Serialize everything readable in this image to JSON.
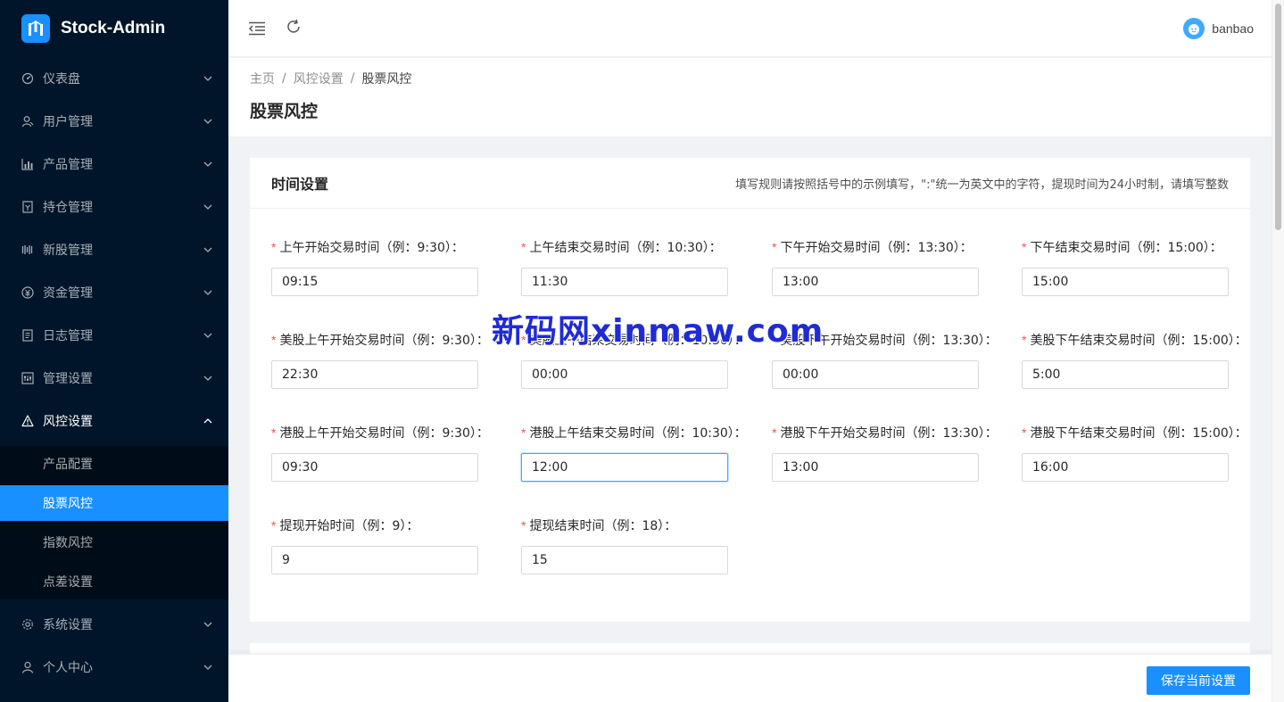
{
  "app": {
    "name": "Stock-Admin"
  },
  "sidebar": {
    "items": [
      {
        "label": "仪表盘",
        "icon": "dashboard-icon"
      },
      {
        "label": "用户管理",
        "icon": "user-icon"
      },
      {
        "label": "产品管理",
        "icon": "chart-icon"
      },
      {
        "label": "持仓管理",
        "icon": "file-icon"
      },
      {
        "label": "新股管理",
        "icon": "barcode-icon"
      },
      {
        "label": "资金管理",
        "icon": "money-icon"
      },
      {
        "label": "日志管理",
        "icon": "log-icon"
      },
      {
        "label": "管理设置",
        "icon": "settings-board-icon"
      },
      {
        "label": "风控设置",
        "icon": "warning-icon"
      },
      {
        "label": "系统设置",
        "icon": "gear-icon"
      },
      {
        "label": "个人中心",
        "icon": "user-icon"
      }
    ],
    "submenu": [
      {
        "label": "产品配置"
      },
      {
        "label": "股票风控"
      },
      {
        "label": "指数风控"
      },
      {
        "label": "点差设置"
      }
    ]
  },
  "header": {
    "username": "banbao"
  },
  "breadcrumb": {
    "home": "主页",
    "section": "风控设置",
    "current": "股票风控",
    "separator": "/"
  },
  "page": {
    "title": "股票风控"
  },
  "card": {
    "title": "时间设置",
    "extra": "填写规则请按照括号中的示例填写，\":\"统一为英文中的字符，提现时间为24小时制，请填写整数"
  },
  "fields": [
    {
      "label": "上午开始交易时间（例：9:30）：",
      "value": "09:15"
    },
    {
      "label": "上午结束交易时间（例：10:30）：",
      "value": "11:30"
    },
    {
      "label": "下午开始交易时间（例：13:30）：",
      "value": "13:00"
    },
    {
      "label": "下午结束交易时间（例：15:00）：",
      "value": "15:00"
    },
    {
      "label": "美股上午开始交易时间（例：9:30）：",
      "value": "22:30"
    },
    {
      "label": "美股上午结束交易时间（例：10:30）：",
      "value": "00:00"
    },
    {
      "label": "美股下午开始交易时间（例：13:30）：",
      "value": "00:00"
    },
    {
      "label": "美股下午结束交易时间（例：15:00）：",
      "value": "5:00"
    },
    {
      "label": "港股上午开始交易时间（例：9:30）：",
      "value": "09:30"
    },
    {
      "label": "港股上午结束交易时间（例：10:30）：",
      "value": "12:00"
    },
    {
      "label": "港股下午开始交易时间（例：13:30）：",
      "value": "13:00"
    },
    {
      "label": "港股下午结束交易时间（例：15:00）：",
      "value": "16:00"
    },
    {
      "label": "提现开始时间（例：9）：",
      "value": "9"
    },
    {
      "label": "提现结束时间（例：18）：",
      "value": "15"
    }
  ],
  "footer": {
    "save_label": "保存当前设置"
  },
  "watermark": "新码网xinmaw.com",
  "colors": {
    "sidebar_bg": "#001529",
    "submenu_bg": "#000c17",
    "accent": "#1890ff",
    "required": "#ff4d4f"
  }
}
